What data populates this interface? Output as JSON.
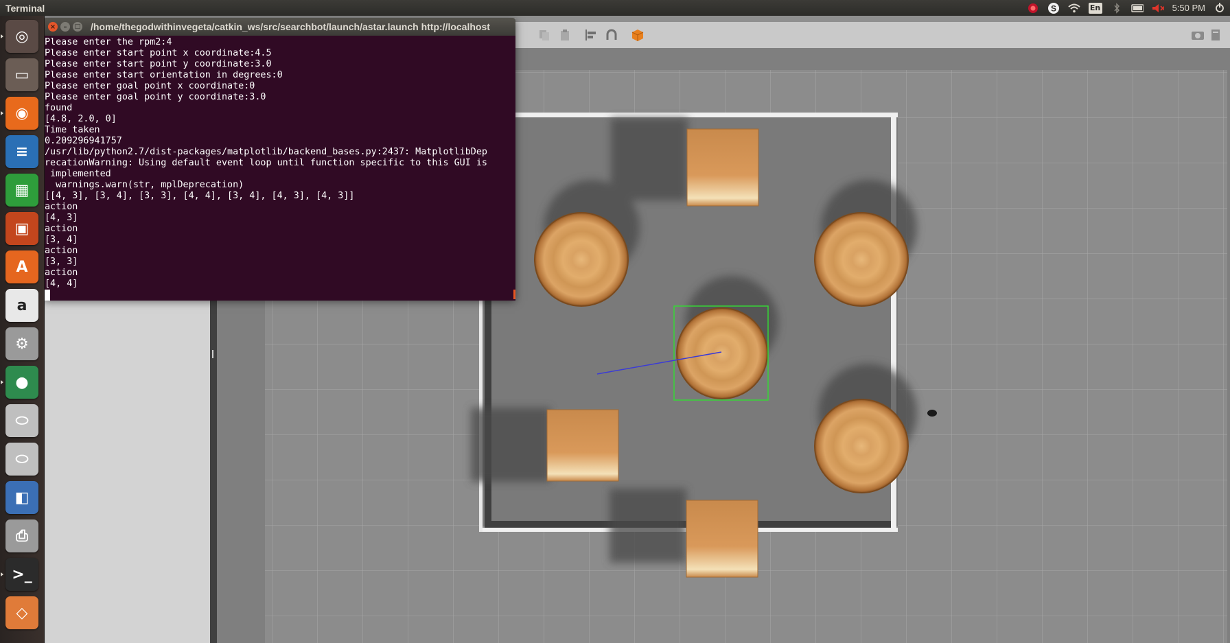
{
  "top_panel": {
    "title": "Terminal",
    "indicators": [
      "record-icon",
      "skype-icon",
      "wifi-icon",
      "keyboard-en-icon",
      "bluetooth-icon",
      "battery-icon",
      "volume-muted-icon",
      "power-icon"
    ],
    "keyboard_label": "En",
    "clock": "5:50 PM"
  },
  "launcher": {
    "items": [
      {
        "name": "dash-icon",
        "color": "#5a4a45"
      },
      {
        "name": "files-icon",
        "color": "#6b5d55"
      },
      {
        "name": "firefox-icon",
        "color": "#e86a1c"
      },
      {
        "name": "writer-icon",
        "color": "#2a6fb5"
      },
      {
        "name": "calc-icon",
        "color": "#2e9d3b"
      },
      {
        "name": "impress-icon",
        "color": "#c3461d"
      },
      {
        "name": "software-center-icon",
        "color": "#e5661f"
      },
      {
        "name": "amazon-icon",
        "color": "#e8e8e8"
      },
      {
        "name": "system-settings-icon",
        "color": "#9a9a9a"
      },
      {
        "name": "gazebo-icon",
        "color": "#2e8b4e"
      },
      {
        "name": "disk-icon",
        "color": "#bfbfbf"
      },
      {
        "name": "disk-2-icon",
        "color": "#bfbfbf"
      },
      {
        "name": "workspaces-icon",
        "color": "#3b6fb5"
      },
      {
        "name": "printer-icon",
        "color": "#9a9a9a"
      },
      {
        "name": "terminal-icon",
        "color": "#2b2b2b"
      },
      {
        "name": "sandbox-icon",
        "color": "#e07b39"
      }
    ]
  },
  "terminal": {
    "title": "/home/thegodwithinvegeta/catkin_ws/src/searchbot/launch/astar.launch http://localhost",
    "lines": [
      "Please enter the rpm2:4",
      "Please enter start point x coordinate:4.5",
      "Please enter start point y coordinate:3.0",
      "Please enter start orientation in degrees:0",
      "Please enter goal point x coordinate:0",
      "Please enter goal point y coordinate:3.0",
      "found",
      "[4.8, 2.0, 0]",
      "Time taken",
      "0.209296941757",
      "/usr/lib/python2.7/dist-packages/matplotlib/backend_bases.py:2437: MatplotlibDep",
      "recationWarning: Using default event loop until function specific to this GUI is",
      " implemented",
      "  warnings.warn(str, mplDeprecation)",
      "[[4, 3], [3, 4], [3, 3], [4, 4], [3, 4], [4, 3], [4, 3]]",
      "action",
      "[4, 3]",
      "action",
      "[3, 4]",
      "action",
      "[3, 3]",
      "action",
      "[4, 4]"
    ],
    "background": "#300a24",
    "foreground": "#ffffff"
  },
  "gazebo": {
    "toolbar_icons": [
      "copy-icon",
      "paste-icon",
      "align-icon",
      "snap-icon",
      "view-angle-icon"
    ],
    "right_icons": [
      "screenshot-icon",
      "log-icon"
    ],
    "obstacles": [
      {
        "kind": "box"
      },
      {
        "kind": "cylinder"
      },
      {
        "kind": "cylinder"
      },
      {
        "kind": "cylinder"
      },
      {
        "kind": "box"
      },
      {
        "kind": "cylinder"
      },
      {
        "kind": "box"
      }
    ]
  }
}
